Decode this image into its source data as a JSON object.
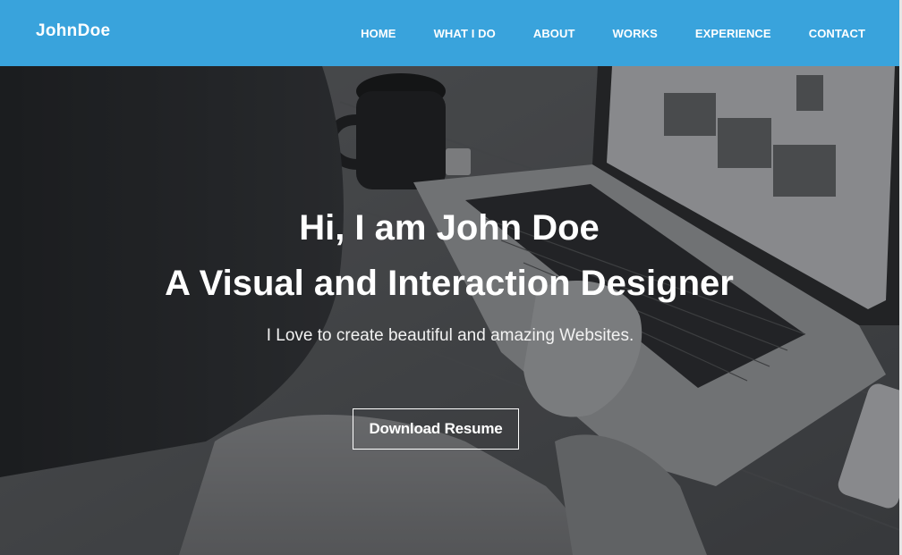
{
  "brand": {
    "name": "JohnDoe"
  },
  "nav": {
    "items": [
      {
        "label": "HOME"
      },
      {
        "label": "WHAT I DO"
      },
      {
        "label": "ABOUT"
      },
      {
        "label": "WORKS"
      },
      {
        "label": "EXPERIENCE"
      },
      {
        "label": "CONTACT"
      }
    ]
  },
  "hero": {
    "title_line1": "Hi, I am John Doe",
    "title_line2": "A Visual and Interaction Designer",
    "subtitle": "I Love to create beautiful and amazing Websites.",
    "cta_label": "Download Resume"
  },
  "colors": {
    "navbar": "#39a3dc",
    "text": "#ffffff",
    "overlay": "#141618"
  }
}
